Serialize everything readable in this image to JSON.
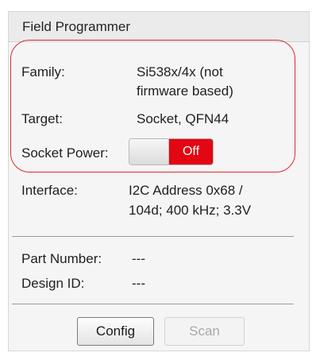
{
  "panel": {
    "title": "Field Programmer"
  },
  "fields": {
    "family_label": "Family:",
    "family_value_line1": "Si538x/4x (not",
    "family_value_line2": "firmware based)",
    "target_label": "Target:",
    "target_value": "Socket, QFN44",
    "socket_power_label": "Socket Power:",
    "socket_power_state": "Off",
    "interface_label": "Interface:",
    "interface_value_line1": "I2C Address 0x68 /",
    "interface_value_line2": "104d; 400 kHz; 3.3V",
    "part_number_label": "Part Number:",
    "part_number_value": "---",
    "design_id_label": "Design ID:",
    "design_id_value": "---"
  },
  "buttons": {
    "config_label": "Config",
    "scan_label": "Scan"
  },
  "colors": {
    "highlight_outline": "#e0282f",
    "toggle_off": "#e30613"
  }
}
